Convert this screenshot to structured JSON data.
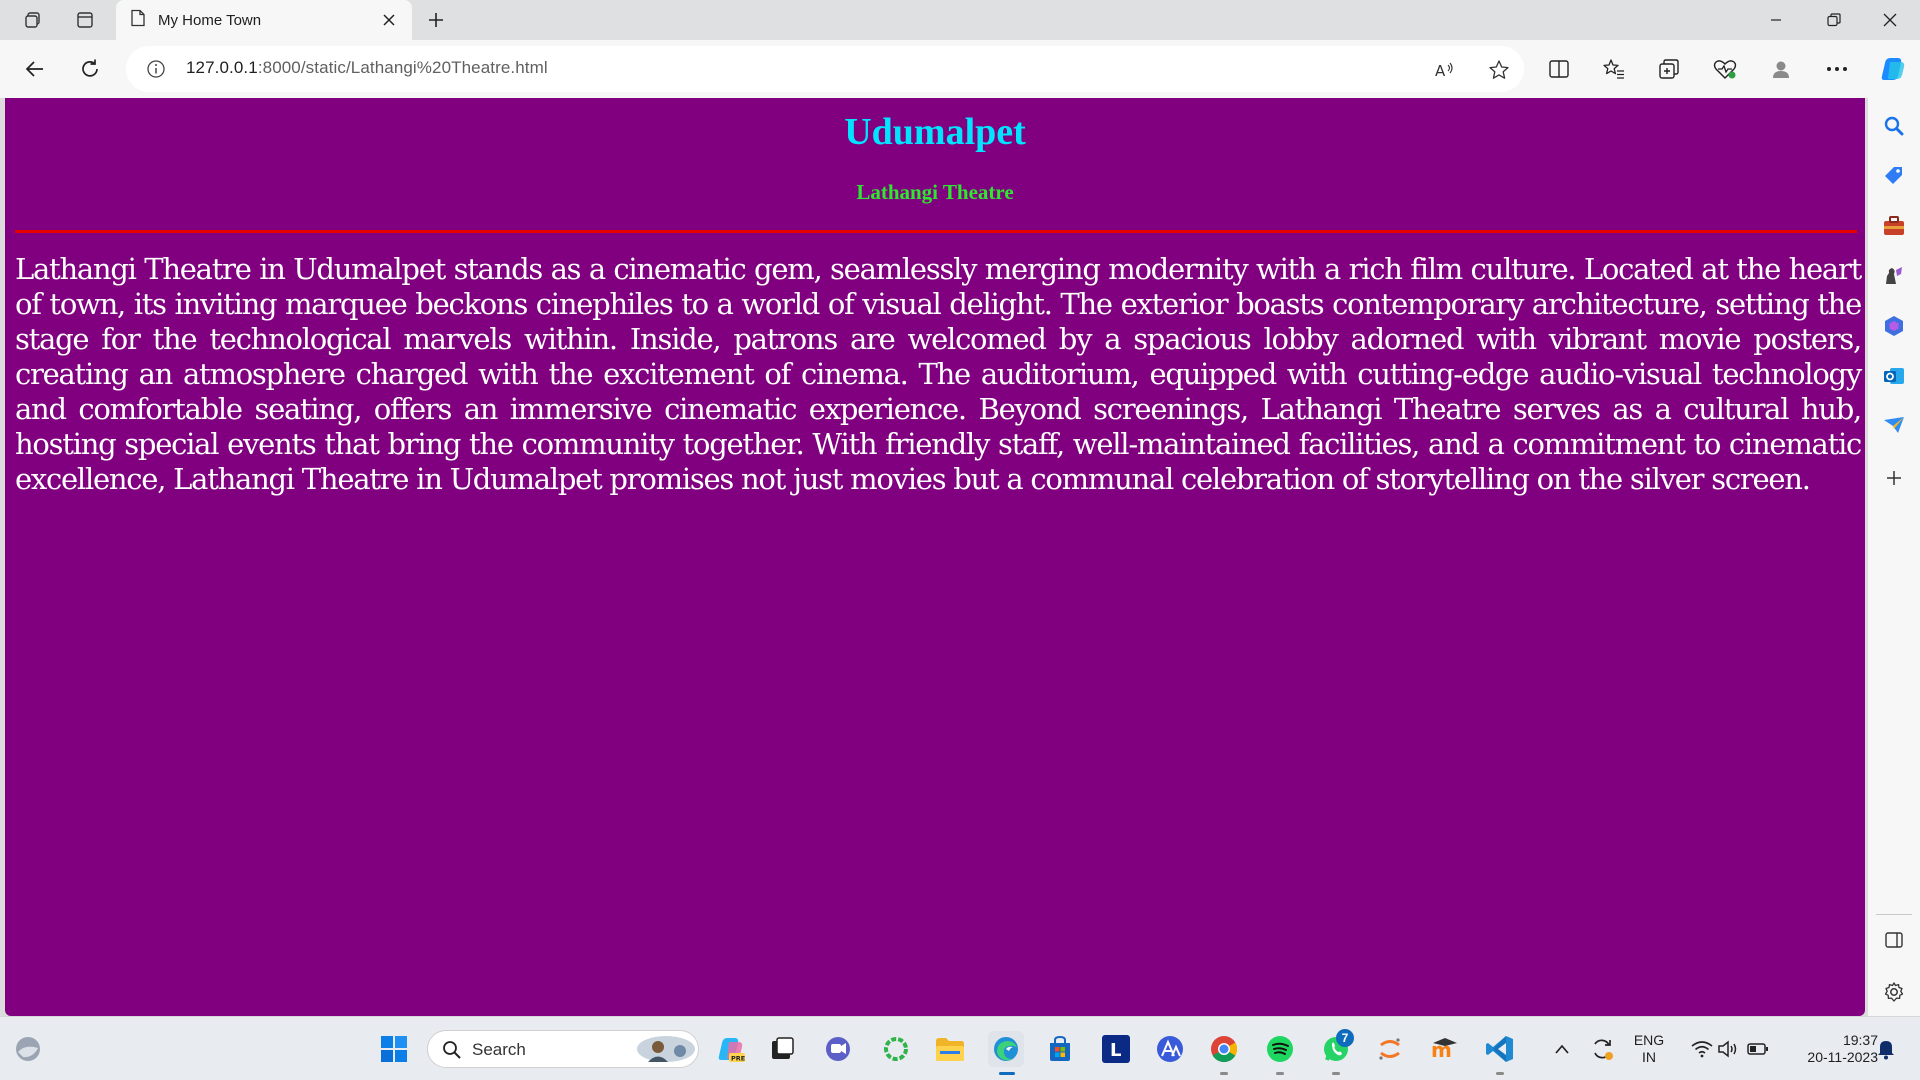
{
  "browser": {
    "tab_title": "My Home Town",
    "url_host": "127.0.0.1",
    "url_path": ":8000/static/Lathangi%20Theatre.html"
  },
  "page": {
    "heading": "Udumalpet",
    "subheading": "Lathangi Theatre",
    "paragraph": "Lathangi Theatre in Udumalpet stands as a cinematic gem, seamlessly merging modernity with a rich film culture. Located at the heart of town, its inviting marquee beckons cinephiles to a world of visual delight. The exterior boasts contemporary architecture, setting the stage for the technological marvels within. Inside, patrons are welcomed by a spacious lobby adorned with vibrant movie posters, creating an atmosphere charged with the excitement of cinema. The auditorium, equipped with cutting-edge audio-visual technology and comfortable seating, offers an immersive cinematic experience. Beyond screenings, Lathangi Theatre serves as a cultural hub, hosting special events that bring the community together. With friendly staff, well-maintained facilities, and a commitment to cinematic excellence, Lathangi Theatre in Udumalpet promises not just movies but a communal celebration of storytelling on the silver screen.",
    "colors": {
      "background": "#800080",
      "heading": "#00e5ff",
      "subheading": "#2ee82e",
      "rule": "#e60000",
      "text": "#ffffff"
    }
  },
  "taskbar": {
    "search_label": "Search",
    "language": "ENG",
    "region": "IN",
    "time": "19:37",
    "date": "20-11-2023",
    "whatsapp_badge": "7"
  },
  "icons": {
    "tabbar": [
      "workspaces-icon",
      "tab-actions-icon",
      "page-icon",
      "close-icon",
      "plus-icon",
      "minimize-icon",
      "restore-icon",
      "close-window-icon"
    ],
    "toolbar": [
      "back-arrow-icon",
      "refresh-icon",
      "info-icon",
      "read-aloud-icon",
      "favorite-star-icon",
      "split-screen-icon",
      "favorites-icon",
      "collections-icon",
      "browser-essentials-icon",
      "profile-icon",
      "more-icon",
      "copilot-icon"
    ],
    "sidebar": [
      "search-icon",
      "shopping-tag-icon",
      "tools-icon",
      "games-icon",
      "microsoft-365-icon",
      "outlook-icon",
      "drop-icon",
      "add-icon",
      "hide-sidebar-icon",
      "settings-icon"
    ]
  }
}
